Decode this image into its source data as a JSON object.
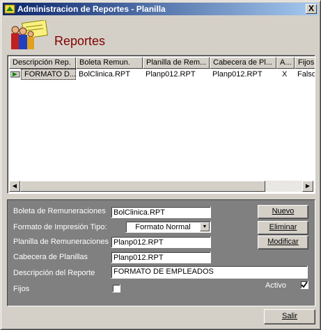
{
  "window": {
    "title": "Administracion de Reportes - Planilla",
    "close_label": "X"
  },
  "header": {
    "title": "Reportes"
  },
  "grid": {
    "columns": [
      "Descripción Rep.",
      "Boleta Remun.",
      "Planilla de Rem...",
      "Cabecera de Pl...",
      "A...",
      "Fijos"
    ],
    "rows": [
      [
        "FORMATO D...",
        "BolClinica.RPT",
        "Planp012.RPT",
        "Planp012.RPT",
        "X",
        "Falso"
      ]
    ]
  },
  "form": {
    "boleta_label": "Boleta de Remuneraciones",
    "boleta_value": "BolClinica.RPT",
    "formato_label": "Formato de Impresión Tipo:",
    "formato_value": "Formato Normal",
    "planilla_label": "Planilla de Remuneraciones",
    "planilla_value": "Planp012.RPT",
    "cabecera_label": "Cabecera de Planillas",
    "cabecera_value": "Planp012.RPT",
    "descripcion_label": "Descripción del Reporte",
    "descripcion_value": "FORMATO DE EMPLEADOS",
    "fijos_label": "Fijos",
    "fijos_checked": false,
    "activo_label": "Activo",
    "activo_checked": true
  },
  "buttons": {
    "nuevo": "Nuevo",
    "eliminar": "Eliminar",
    "modificar": "Modificar",
    "salir": "Salir"
  },
  "colors": {
    "titlebar_start": "#0a246a",
    "titlebar_end": "#a6caf0",
    "header_title": "#800000",
    "panel": "#808080"
  }
}
